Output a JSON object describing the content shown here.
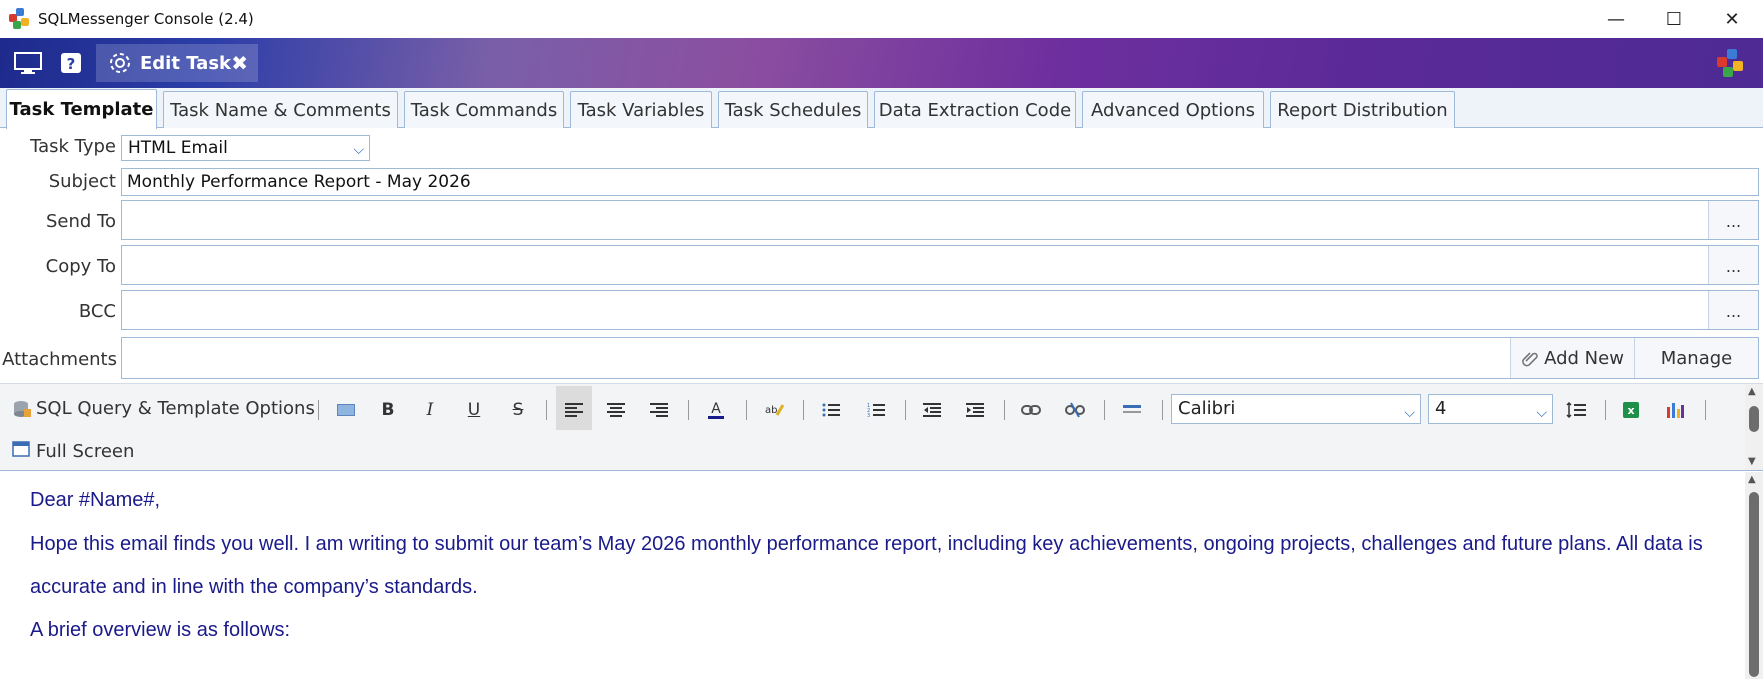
{
  "window": {
    "title": "SQLMessenger Console (2.4)",
    "minimize": "—",
    "maximize": "☐",
    "close": "✕"
  },
  "header": {
    "edit_tab_label": "Edit Task",
    "edit_tab_close": "✖"
  },
  "tabs": [
    {
      "label": "Task Template",
      "active": true
    },
    {
      "label": "Task Name & Comments"
    },
    {
      "label": "Task Commands"
    },
    {
      "label": "Task Variables"
    },
    {
      "label": "Task Schedules"
    },
    {
      "label": "Data Extraction Code"
    },
    {
      "label": "Advanced Options"
    },
    {
      "label": "Report Distribution"
    }
  ],
  "form": {
    "task_type_label": "Task Type",
    "task_type_value": "HTML Email",
    "subject_label": "Subject",
    "subject_value": "Monthly Performance Report - May 2026",
    "send_to_label": "Send To",
    "send_to_value": "",
    "copy_to_label": "Copy To",
    "copy_to_value": "",
    "bcc_label": "BCC",
    "bcc_value": "",
    "attachments_label": "Attachments",
    "ellipsis": "...",
    "add_new_label": "Add New",
    "manage_label": "Manage"
  },
  "toolbar": {
    "sql_options_label": "SQL Query & Template Options",
    "full_screen_label": "Full Screen",
    "bold": "B",
    "italic": "I",
    "underline": "U",
    "strike": "S",
    "font_value": "Calibri",
    "size_value": "4"
  },
  "editor": {
    "paragraphs": [
      "Dear #Name#,",
      "Hope this email finds you well. I am writing to submit our team’s May 2026 monthly performance report, including key achievements, ongoing projects, challenges and future plans. All data is accurate and in line with the company’s standards.",
      "A brief overview is as follows:"
    ],
    "text_color": "#1a1a8a"
  }
}
